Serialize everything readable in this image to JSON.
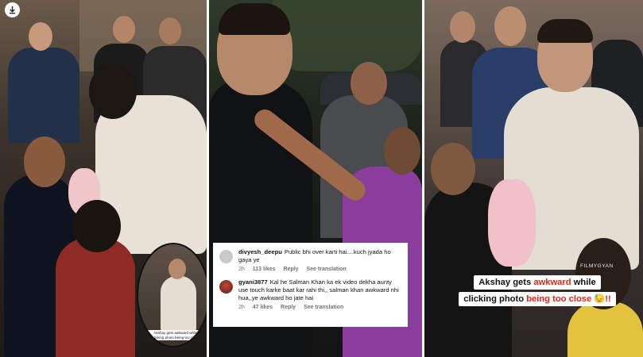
{
  "download_icon": "download-arrow-icon",
  "inset": {
    "caption_line1": "Akshay gets awkward while",
    "caption_line2": "clicking photo being too close"
  },
  "comments": [
    {
      "username": "divyesh_deepu",
      "text": "Public bhi over karti hai....kuch jyada ho gaya ye",
      "time": "2h",
      "likes": "113 likes",
      "reply": "Reply",
      "translation": "See translation"
    },
    {
      "username": "gyani3877",
      "text": "Kal he Salman Khan ka ek video dekha aunty use touch karke baat kar rahi thi,, salman khan awkward nhi hua,,ye awkward ho jate hai",
      "time": "2h",
      "likes": "47 likes",
      "reply": "Reply",
      "translation": "See translation"
    }
  ],
  "caption": {
    "line1_a": "Akshay gets ",
    "line1_red": "awkward",
    "line1_b": " while",
    "line2_a": "clicking photo ",
    "line2_red": "being too close",
    "line2_emoji": "😓",
    "line2_marks": "!!"
  },
  "watermark": "FILMYGYAN",
  "colors": {
    "accent_red": "#e0251b"
  }
}
